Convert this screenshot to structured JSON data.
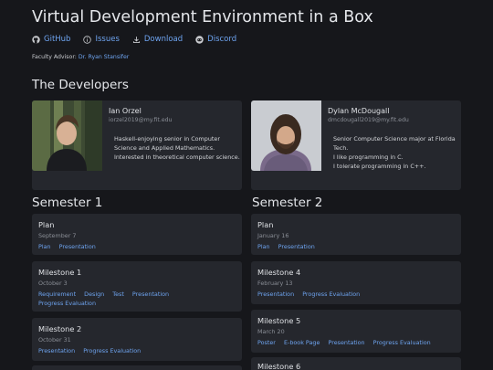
{
  "header": {
    "title": "Virtual Development Environment in a Box",
    "links": [
      {
        "label": "GitHub",
        "icon": "github-icon"
      },
      {
        "label": "Issues",
        "icon": "info-circle-icon"
      },
      {
        "label": "Download",
        "icon": "download-icon"
      },
      {
        "label": "Discord",
        "icon": "discord-icon"
      }
    ],
    "advisor_label": "Faculty Advisor:",
    "advisor_name": "Dr. Ryan Stansifer"
  },
  "developers_heading": "The Developers",
  "developers": [
    {
      "name": "Ian Orzel",
      "email": "iorzel2019@my.fit.edu",
      "bio": "Haskell-enjoying senior in Computer Science and Applied Mathematics. Interested in theoretical computer science."
    },
    {
      "name": "Dylan McDougall",
      "email": "dmcdougall2019@my.fit.edu",
      "bio_lines": [
        "Senior Computer Science major at Florida Tech.",
        "I like programming in C.",
        "I tolerate programming in C++."
      ]
    }
  ],
  "semester1": {
    "heading": "Semester 1",
    "milestones": [
      {
        "title": "Plan",
        "date": "September 7",
        "links": [
          "Plan",
          "Presentation"
        ]
      },
      {
        "title": "Milestone 1",
        "date": "October 3",
        "links": [
          "Requirement",
          "Design",
          "Test",
          "Presentation",
          "Progress Evaluation"
        ]
      },
      {
        "title": "Milestone 2",
        "date": "October 31",
        "links": [
          "Presentation",
          "Progress Evaluation"
        ]
      }
    ]
  },
  "semester2": {
    "heading": "Semester 2",
    "milestones": [
      {
        "title": "Plan",
        "date": "January 16",
        "links": [
          "Plan",
          "Presentation"
        ]
      },
      {
        "title": "Milestone 4",
        "date": "February 13",
        "links": [
          "Presentation",
          "Progress Evaluation"
        ]
      },
      {
        "title": "Milestone 5",
        "date": "March 20",
        "links": [
          "Poster",
          "E-book Page",
          "Presentation",
          "Progress Evaluation"
        ]
      },
      {
        "title": "Milestone 6",
        "date": "",
        "links": []
      }
    ]
  },
  "colors": {
    "background": "#16171b",
    "card": "#25272d",
    "link": "#6ea4f0"
  }
}
